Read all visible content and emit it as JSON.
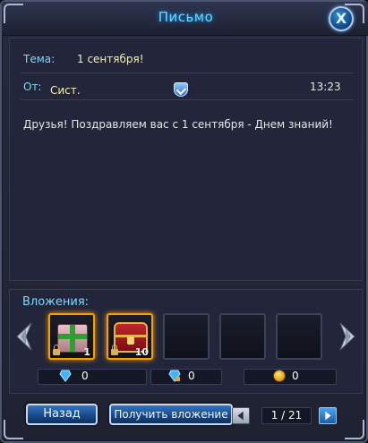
{
  "window": {
    "title": "Письмо",
    "close_label": "X"
  },
  "letter": {
    "subject_label": "Тема:",
    "subject": "1 сентября!",
    "from_label": "От:",
    "from": "Сист.",
    "time": "13:23",
    "body": "Друзья! Поздравляем вас с 1 сентября - Днем знаний!"
  },
  "attachments": {
    "title": "Вложения:",
    "slots": [
      {
        "item": "gift-box",
        "count": "1",
        "bound": true
      },
      {
        "item": "treasure-chest",
        "count": "10",
        "bound": true
      },
      {
        "item": null
      },
      {
        "item": null
      },
      {
        "item": null
      }
    ],
    "currencies": [
      {
        "icon": "diamond-icon",
        "value": "0"
      },
      {
        "icon": "bound-diamond-icon",
        "value": "0"
      },
      {
        "icon": "gold-coin-icon",
        "value": "0"
      }
    ]
  },
  "footer": {
    "back_label": "Назад",
    "claim_label": "Получить вложение",
    "page": "1 / 21"
  },
  "colors": {
    "accent": "#7fd8ff",
    "title_glow": "#1aa7ff",
    "highlight": "#f0a300"
  }
}
